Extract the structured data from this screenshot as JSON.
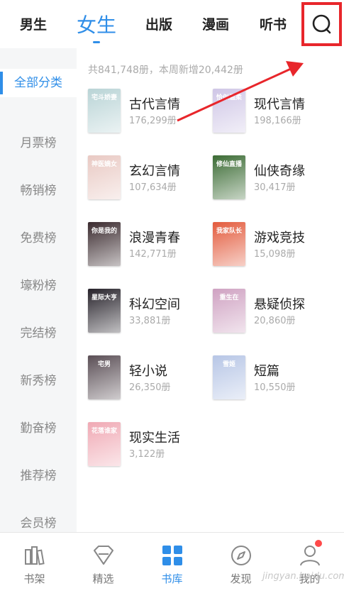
{
  "colors": {
    "accent": "#2f8ee8",
    "highlight_box": "#e8262b",
    "arrow": "#e8262b",
    "badge": "#ff4a4a"
  },
  "top_tabs": [
    {
      "label": "男生"
    },
    {
      "label": "女生",
      "active": true
    },
    {
      "label": "出版"
    },
    {
      "label": "漫画"
    },
    {
      "label": "听书"
    }
  ],
  "search": {
    "icon": "search-icon"
  },
  "sidebar": {
    "items": [
      {
        "label": "全部分类",
        "active": true
      },
      {
        "label": "月票榜"
      },
      {
        "label": "畅销榜"
      },
      {
        "label": "免费榜"
      },
      {
        "label": "壕粉榜"
      },
      {
        "label": "完结榜"
      },
      {
        "label": "新秀榜"
      },
      {
        "label": "勤奋榜"
      },
      {
        "label": "推荐榜"
      },
      {
        "label": "会员榜"
      }
    ]
  },
  "summary": "共841,748册，本周新增20,442册",
  "categories": [
    {
      "name": "古代言情",
      "count": "176,299册",
      "cover_text": "宅斗娇妻",
      "cover_color": "#b9d4d6"
    },
    {
      "name": "现代言情",
      "count": "198,166册",
      "cover_text": "恰似温柔",
      "cover_color": "#cfc6e6"
    },
    {
      "name": "玄幻言情",
      "count": "107,634册",
      "cover_text": "神医嫡女",
      "cover_color": "#e9c9c3"
    },
    {
      "name": "仙侠奇缘",
      "count": "30,417册",
      "cover_text": "修仙直播",
      "cover_color": "#3b6b34"
    },
    {
      "name": "浪漫青春",
      "count": "142,771册",
      "cover_text": "你是我的",
      "cover_color": "#3a2a2e"
    },
    {
      "name": "游戏竞技",
      "count": "15,098册",
      "cover_text": "我家队长",
      "cover_color": "#e35b3d"
    },
    {
      "name": "科幻空间",
      "count": "33,881册",
      "cover_text": "星际大亨",
      "cover_color": "#26222a"
    },
    {
      "name": "悬疑侦探",
      "count": "20,860册",
      "cover_text": "重生在",
      "cover_color": "#cfa2c2"
    },
    {
      "name": "轻小说",
      "count": "26,350册",
      "cover_text": "宅男",
      "cover_color": "#5a4e55"
    },
    {
      "name": "短篇",
      "count": "10,550册",
      "cover_text": "雪姬",
      "cover_color": "#b7c6e6"
    },
    {
      "name": "现实生活",
      "count": "3,122册",
      "cover_text": "花落谁家",
      "cover_color": "#f0a9b4"
    }
  ],
  "bottom_nav": [
    {
      "label": "书架",
      "icon": "bookshelf-icon"
    },
    {
      "label": "精选",
      "icon": "diamond-icon"
    },
    {
      "label": "书库",
      "icon": "grid-icon",
      "active": true
    },
    {
      "label": "发现",
      "icon": "compass-icon"
    },
    {
      "label": "我的",
      "icon": "user-icon"
    }
  ],
  "watermark": "jingyan.baidu.com"
}
